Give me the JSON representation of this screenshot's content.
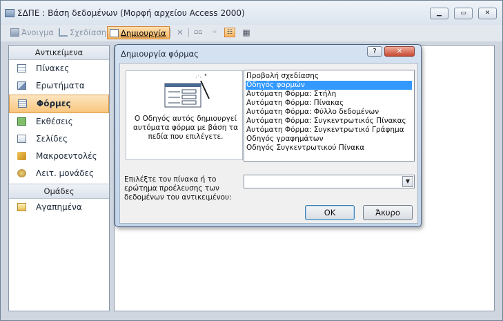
{
  "window": {
    "title": "ΣΔΠΕ : Βάση δεδομένων (Μορφή αρχείου Access 2000)",
    "min_icon": "minimize-icon",
    "max_icon": "maximize-icon",
    "close_icon": "close-icon"
  },
  "toolbar": {
    "open_label": "Άνοιγμα",
    "design_label": "Σχεδίαση",
    "new_label": "Δημιουργία"
  },
  "sidebar": {
    "header": "Αντικείμενα",
    "items": [
      {
        "label": "Πίνακες",
        "icon": "table-icon"
      },
      {
        "label": "Ερωτήματα",
        "icon": "query-icon"
      },
      {
        "label": "Φόρμες",
        "icon": "form-icon"
      },
      {
        "label": "Εκθέσεις",
        "icon": "report-icon"
      },
      {
        "label": "Σελίδες",
        "icon": "page-icon"
      },
      {
        "label": "Μακροεντολές",
        "icon": "macro-icon"
      },
      {
        "label": "Λειτ. μονάδες",
        "icon": "module-icon"
      }
    ],
    "groups_header": "Ομάδες",
    "group_items": [
      {
        "label": "Αγαπημένα",
        "icon": "favorites-icon"
      }
    ]
  },
  "dialog": {
    "title": "Δημιουργία φόρμας",
    "help_label": "?",
    "close_label": "✕",
    "description": "Ο Οδηγός αυτός δημιουργεί αυτόματα φόρμα με βάση τα πεδία που επιλέγετε.",
    "list": [
      "Προβολή σχεδίασης",
      "Οδηγός φορμών",
      "Αυτόματη Φόρμα: Στήλη",
      "Αυτόματη Φόρμα: Πίνακας",
      "Αυτόματη Φόρμα: Φύλλο δεδομένων",
      "Αυτόματη Φόρμα:  Συγκεντρωτικός Πίνακας",
      "Αυτόματη Φόρμα:  Συγκεντρωτικό Γράφημα",
      "Οδηγός γραφημάτων",
      "Οδηγός Συγκεντρωτικού Πίνακα"
    ],
    "selected_index": 1,
    "source_label": "Επιλέξτε τον πίνακα ή το ερώτημα προέλευσης των δεδομένων του αντικειμένου:",
    "source_value": "",
    "ok_label": "OK",
    "cancel_label": "Άκυρο"
  },
  "colors": {
    "accent": "#f6b35c",
    "selection": "#3399ff"
  }
}
